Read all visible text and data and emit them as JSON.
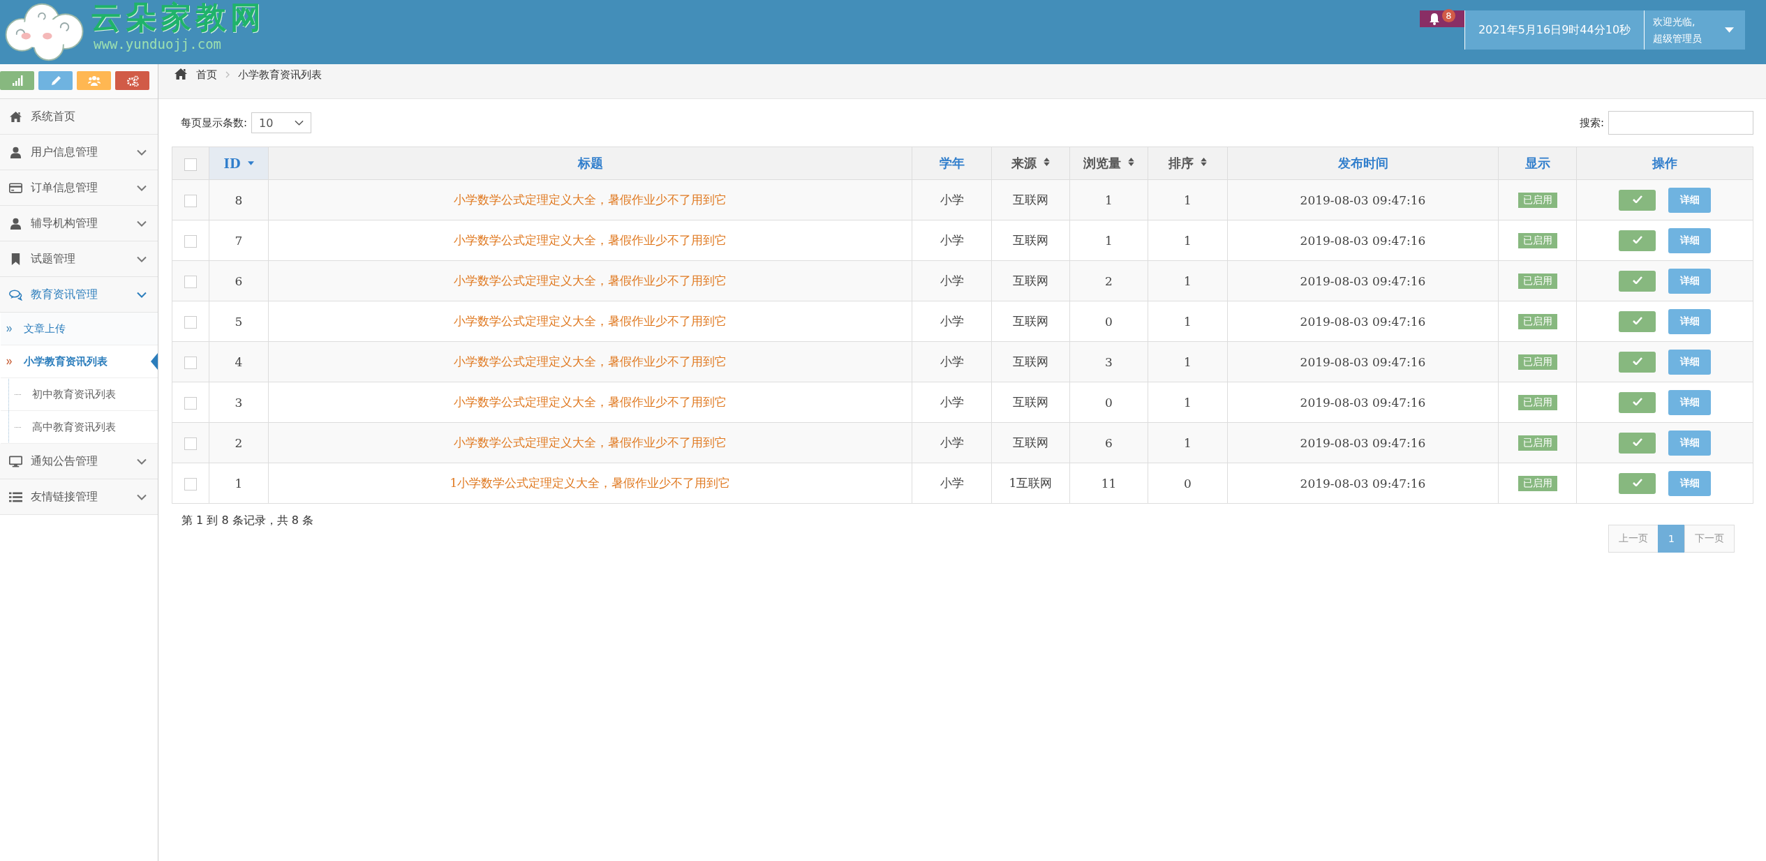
{
  "header": {
    "site_name": "云朵家教网",
    "site_url": "www.yunduojj.com",
    "notifications": "8",
    "datetime": "2021年5月16日9时44分10秒",
    "welcome": "欢迎光临,",
    "user": "超级管理员"
  },
  "shortcuts": [
    {
      "color": "#87b87f"
    },
    {
      "color": "#6fb3e0"
    },
    {
      "color": "#ffb752"
    },
    {
      "color": "#d15b47"
    }
  ],
  "sidebar": {
    "items": [
      {
        "label": "系统首页",
        "expandable": false,
        "selected": false
      },
      {
        "label": "用户信息管理",
        "expandable": true,
        "selected": false
      },
      {
        "label": "订单信息管理",
        "expandable": true,
        "selected": false
      },
      {
        "label": "辅导机构管理",
        "expandable": true,
        "selected": false
      },
      {
        "label": "试题管理",
        "expandable": true,
        "selected": false
      },
      {
        "label": "教育资讯管理",
        "expandable": true,
        "selected": true,
        "children": [
          {
            "label": "文章上传",
            "selected": false,
            "hover": true
          },
          {
            "label": "小学教育资讯列表",
            "selected": true,
            "hover": false
          },
          {
            "label": "初中教育资讯列表",
            "selected": false,
            "hover": false
          },
          {
            "label": "高中教育资讯列表",
            "selected": false,
            "hover": false
          }
        ]
      },
      {
        "label": "通知公告管理",
        "expandable": true,
        "selected": false
      },
      {
        "label": "友情链接管理",
        "expandable": true,
        "selected": false
      }
    ]
  },
  "breadcrumb": [
    "首页",
    "小学教育资讯列表"
  ],
  "page_size": {
    "label": "每页显示条数:",
    "value": "10"
  },
  "search": {
    "label": "搜索:"
  },
  "table": {
    "select_all": {
      "checked": false
    },
    "columns": [
      {
        "label": "ID",
        "sortable": true,
        "sorted": true
      },
      {
        "label": "标题",
        "sortable": false,
        "sorted": false
      },
      {
        "label": "学年",
        "sortable": false,
        "sorted": false
      },
      {
        "label": "来源",
        "sortable": true,
        "sorted": false
      },
      {
        "label": "浏览量",
        "sortable": true,
        "sorted": false
      },
      {
        "label": "排序",
        "sortable": true,
        "sorted": false
      },
      {
        "label": "发布时间",
        "sortable": false,
        "sorted": false
      },
      {
        "label": "显示",
        "sortable": false,
        "sorted": false
      },
      {
        "label": "操作",
        "sortable": false,
        "sorted": false
      }
    ],
    "rows": [
      {
        "checked": false,
        "id": "8",
        "title": "小学数学公式定理定义大全，暑假作业少不了用到它",
        "grade": "小学",
        "source": "互联网",
        "views": "1",
        "order": "1",
        "time": "2019-08-03 09:47:16",
        "status": "已启用",
        "detail": "详细"
      },
      {
        "checked": false,
        "id": "7",
        "title": "小学数学公式定理定义大全，暑假作业少不了用到它",
        "grade": "小学",
        "source": "互联网",
        "views": "1",
        "order": "1",
        "time": "2019-08-03 09:47:16",
        "status": "已启用",
        "detail": "详细"
      },
      {
        "checked": false,
        "id": "6",
        "title": "小学数学公式定理定义大全，暑假作业少不了用到它",
        "grade": "小学",
        "source": "互联网",
        "views": "2",
        "order": "1",
        "time": "2019-08-03 09:47:16",
        "status": "已启用",
        "detail": "详细"
      },
      {
        "checked": false,
        "id": "5",
        "title": "小学数学公式定理定义大全，暑假作业少不了用到它",
        "grade": "小学",
        "source": "互联网",
        "views": "0",
        "order": "1",
        "time": "2019-08-03 09:47:16",
        "status": "已启用",
        "detail": "详细"
      },
      {
        "checked": false,
        "id": "4",
        "title": "小学数学公式定理定义大全，暑假作业少不了用到它",
        "grade": "小学",
        "source": "互联网",
        "views": "3",
        "order": "1",
        "time": "2019-08-03 09:47:16",
        "status": "已启用",
        "detail": "详细"
      },
      {
        "checked": false,
        "id": "3",
        "title": "小学数学公式定理定义大全，暑假作业少不了用到它",
        "grade": "小学",
        "source": "互联网",
        "views": "0",
        "order": "1",
        "time": "2019-08-03 09:47:16",
        "status": "已启用",
        "detail": "详细"
      },
      {
        "checked": false,
        "id": "2",
        "title": "小学数学公式定理定义大全，暑假作业少不了用到它",
        "grade": "小学",
        "source": "互联网",
        "views": "6",
        "order": "1",
        "time": "2019-08-03 09:47:16",
        "status": "已启用",
        "detail": "详细"
      },
      {
        "checked": false,
        "id": "1",
        "title": "1小学数学公式定理定义大全，暑假作业少不了用到它",
        "grade": "小学",
        "source": "1互联网",
        "views": "11",
        "order": "0",
        "time": "2019-08-03 09:47:16",
        "status": "已启用",
        "detail": "详细"
      }
    ]
  },
  "footer": {
    "info": "第 1 到 8 条记录，共 8 条",
    "pages": [
      {
        "label": "上一页",
        "selected": false,
        "disabled": true
      },
      {
        "label": "1",
        "selected": true,
        "disabled": false
      },
      {
        "label": "下一页",
        "selected": false,
        "disabled": true
      }
    ]
  }
}
